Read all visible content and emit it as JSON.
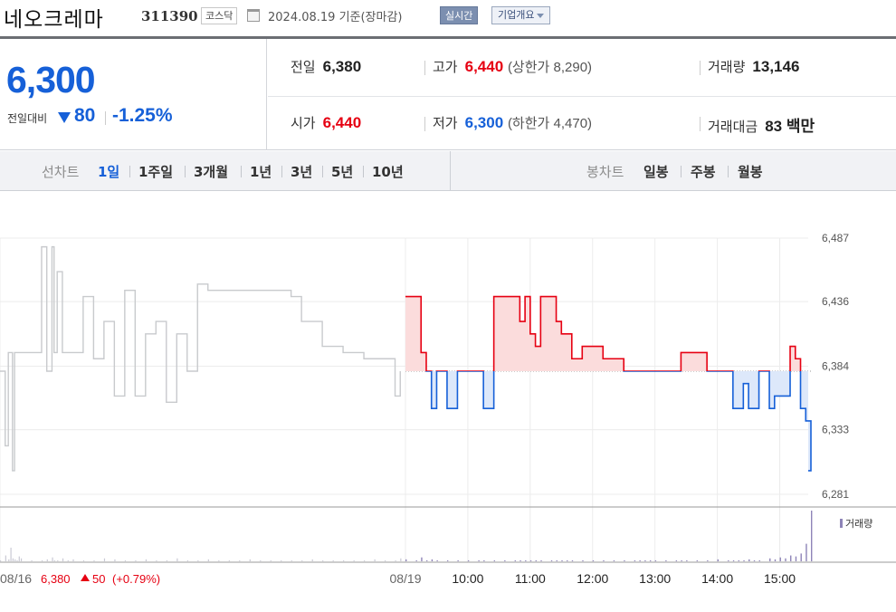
{
  "header": {
    "name": "네오크레마",
    "code": "311390",
    "market": "코스닥",
    "date": "2024.08.19 기준(장마감)",
    "realtime": "실시간",
    "overview": "기업개요"
  },
  "price": {
    "current": "6,300",
    "compare_label": "전일대비",
    "change": "80",
    "change_pct": "-1.25%"
  },
  "stats": {
    "prev_close": {
      "label": "전일",
      "value": "6,380"
    },
    "high": {
      "label": "고가",
      "value": "6,440",
      "upper_limit": "(상한가 8,290)"
    },
    "volume": {
      "label": "거래량",
      "value": "13,146"
    },
    "open": {
      "label": "시가",
      "value": "6,440"
    },
    "low": {
      "label": "저가",
      "value": "6,300",
      "lower_limit": "(하한가 4,470)"
    },
    "amount": {
      "label": "거래대금",
      "value": "83 백만"
    }
  },
  "tabs": {
    "line_label": "선차트",
    "ranges": [
      "1일",
      "1주일",
      "3개월",
      "1년",
      "3년",
      "5년",
      "10년"
    ],
    "active_range": "1일",
    "candle_label": "봉차트",
    "candles": [
      "일봉",
      "주봉",
      "월봉"
    ]
  },
  "colors": {
    "up": "#e60012",
    "down": "#1660d8",
    "prev_line": "#c8cacd",
    "volume": "#8e84b8"
  },
  "chart_data": {
    "type": "line",
    "y_ticks": [
      "6,487",
      "6,436",
      "6,384",
      "6,333",
      "6,281"
    ],
    "y_range": [
      6281,
      6487
    ],
    "baseline": 6380,
    "x_ticks": [
      "08/19",
      "10:00",
      "11:00",
      "12:00",
      "13:00",
      "14:00",
      "15:00"
    ],
    "volume_label": "거래량",
    "prev_day": {
      "label": "08/16",
      "close": "6,380",
      "change": "50",
      "change_pct": "(+0.79%)",
      "x": [
        "09:00",
        "09:05",
        "09:08",
        "09:10",
        "09:12",
        "09:14",
        "09:16",
        "09:18",
        "09:20",
        "09:30",
        "09:40",
        "09:45",
        "09:50",
        "09:52",
        "09:55",
        "10:00",
        "10:05",
        "10:10",
        "10:20",
        "10:30",
        "10:40",
        "10:50",
        "11:00",
        "11:10",
        "11:20",
        "11:30",
        "11:40",
        "11:50",
        "12:00",
        "12:10",
        "12:20",
        "12:30",
        "12:40",
        "12:50",
        "13:00",
        "13:10",
        "13:20",
        "13:30",
        "13:40",
        "13:50",
        "14:00",
        "14:10",
        "14:20",
        "14:30",
        "14:40",
        "14:50",
        "15:00",
        "15:10",
        "15:20",
        "15:25"
      ],
      "y": [
        6380,
        6320,
        6395,
        6395,
        6300,
        6395,
        6395,
        6395,
        6395,
        6395,
        6480,
        6380,
        6480,
        6395,
        6460,
        6395,
        6395,
        6395,
        6440,
        6390,
        6420,
        6360,
        6445,
        6360,
        6410,
        6420,
        6355,
        6410,
        6380,
        6450,
        6445,
        6445,
        6445,
        6445,
        6445,
        6445,
        6445,
        6445,
        6440,
        6420,
        6420,
        6400,
        6400,
        6395,
        6395,
        6390,
        6390,
        6390,
        6360,
        6380
      ]
    },
    "today": {
      "x": [
        "09:00",
        "09:10",
        "09:15",
        "09:20",
        "09:25",
        "09:30",
        "09:40",
        "09:50",
        "10:00",
        "10:10",
        "10:15",
        "10:25",
        "10:35",
        "10:45",
        "10:50",
        "10:55",
        "11:00",
        "11:05",
        "11:10",
        "11:20",
        "11:25",
        "11:30",
        "11:35",
        "11:40",
        "11:50",
        "12:00",
        "12:10",
        "12:20",
        "12:30",
        "12:40",
        "12:45",
        "12:50",
        "12:55",
        "13:00",
        "13:10",
        "13:20",
        "13:25",
        "13:30",
        "13:40",
        "13:50",
        "14:00",
        "14:10",
        "14:15",
        "14:20",
        "14:25",
        "14:30",
        "14:35",
        "14:40",
        "14:50",
        "14:55",
        "15:00",
        "15:05",
        "15:10",
        "15:15",
        "15:20",
        "15:25",
        "15:30"
      ],
      "y": [
        6440,
        6440,
        6395,
        6380,
        6350,
        6380,
        6350,
        6380,
        6380,
        6380,
        6350,
        6440,
        6440,
        6440,
        6420,
        6440,
        6410,
        6400,
        6440,
        6440,
        6420,
        6410,
        6410,
        6390,
        6400,
        6400,
        6390,
        6390,
        6380,
        6380,
        6380,
        6380,
        6380,
        6380,
        6380,
        6380,
        6395,
        6395,
        6395,
        6380,
        6380,
        6380,
        6350,
        6350,
        6370,
        6350,
        6350,
        6380,
        6350,
        6360,
        6360,
        6360,
        6400,
        6390,
        6350,
        6340,
        6300
      ]
    },
    "volumes_prev": [
      1,
      6,
      2,
      14,
      3,
      2,
      1,
      5,
      3,
      1,
      1,
      2,
      4,
      1,
      1,
      3,
      1,
      2,
      1,
      1,
      3,
      2,
      1,
      1,
      2,
      1,
      1,
      3,
      1,
      1,
      2,
      1,
      1,
      1,
      2,
      1,
      1,
      1,
      1,
      1,
      2,
      1,
      1,
      1,
      1,
      1,
      2,
      1,
      1,
      3
    ],
    "volumes_today": [
      2,
      1,
      4,
      1,
      2,
      1,
      1,
      1,
      1,
      1,
      1,
      1,
      1,
      1,
      1,
      1,
      1,
      1,
      1,
      1,
      1,
      1,
      1,
      1,
      1,
      1,
      1,
      1,
      1,
      1,
      1,
      1,
      1,
      1,
      1,
      1,
      1,
      1,
      1,
      1,
      2,
      1,
      1,
      1,
      1,
      2,
      1,
      1,
      3,
      2,
      4,
      3,
      6,
      5,
      8,
      18,
      52
    ]
  }
}
